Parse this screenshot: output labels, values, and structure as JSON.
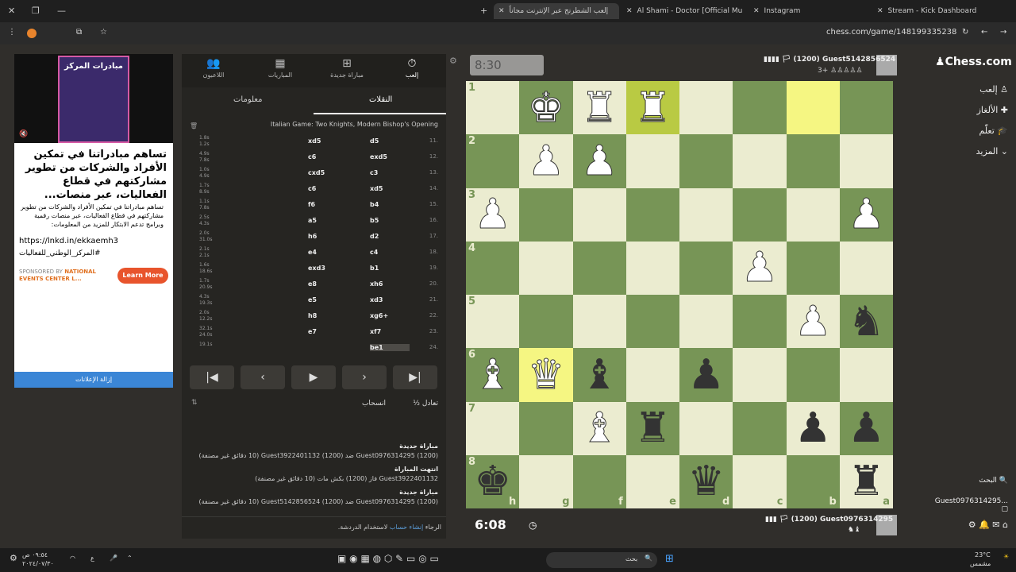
{
  "tabs": [
    {
      "label": "إلعب الشطرنج عبر الإنترنت مجاناً"
    },
    {
      "label": "Al Shami - Doctor [Official Mu"
    },
    {
      "label": "Instagram"
    },
    {
      "label": "Stream - Kick Dashboard"
    }
  ],
  "address": {
    "url": "chess.com/game/148199335238"
  },
  "ad": {
    "image_text": "مبادرات المركز",
    "title": "تساهم مبادراتنا في تمكين الأفراد والشركات من تطوير مشاركتهم في قطاع الفعاليات، عبر منصات...",
    "body": "تساهم مبادراتنا في تمكين الأفراد والشركات من تطوير مشاركتهم في قطاع الفعاليات، عبر منصات رقمية وبرامج تدعم الابتكار للمزيد من المعلومات:",
    "link": "https://lnkd.in/ekkaemh3",
    "hashtag": "المركز_الوطني_للفعاليات#",
    "sponsored_label": "SPONSORED BY",
    "sponsor": "NATIONAL EVENTS CENTER L...",
    "cta": "Learn More",
    "remove": "إزالة الإعلانات"
  },
  "panel": {
    "nav": [
      {
        "label": "إلعب",
        "icon": "stopwatch-icon"
      },
      {
        "label": "مباراة جديدة",
        "icon": "plus-icon"
      },
      {
        "label": "المباريات",
        "icon": "board-icon"
      },
      {
        "label": "اللاعبون",
        "icon": "players-icon"
      }
    ],
    "tab_moves": "النقلات",
    "tab_info": "معلومات",
    "opening": "Italian Game: Two Knights, Modern Bishop's Opening",
    "moves": [
      {
        "n": "11.",
        "w": "d5",
        "b": "xd5",
        "tw": "1.8s",
        "tb": "1.2s"
      },
      {
        "n": "12.",
        "w": "exd5",
        "b": "c6",
        "tw": "4.9s",
        "tb": "7.8s"
      },
      {
        "n": "13.",
        "w": "c3",
        "b": "cxd5",
        "tw": "1.0s",
        "tb": "4.9s"
      },
      {
        "n": "14.",
        "w": "xd5",
        "b": "c6",
        "tw": "1.7s",
        "tb": "8.9s"
      },
      {
        "n": "15.",
        "w": "b4",
        "b": "f6",
        "tw": "1.1s",
        "tb": "7.8s"
      },
      {
        "n": "16.",
        "w": "b5",
        "b": "a5",
        "tw": "2.5s",
        "tb": "4.3s"
      },
      {
        "n": "17.",
        "w": "d2",
        "b": "h6",
        "tw": "2.0s",
        "tb": "31.0s"
      },
      {
        "n": "18.",
        "w": "c4",
        "b": "e4",
        "tw": "2.1s",
        "tb": "2.1s"
      },
      {
        "n": "19.",
        "w": "b1",
        "b": "exd3",
        "tw": "1.6s",
        "tb": "18.6s"
      },
      {
        "n": "20.",
        "w": "xh6",
        "b": "e8",
        "tw": "1.7s",
        "tb": "20.9s"
      },
      {
        "n": "21.",
        "w": "xd3",
        "b": "e5",
        "tw": "4.3s",
        "tb": "19.3s"
      },
      {
        "n": "22.",
        "w": "xg6+",
        "b": "h8",
        "tw": "2.0s",
        "tb": "12.2s"
      },
      {
        "n": "23.",
        "w": "xf7",
        "b": "e7",
        "tw": "32.1s",
        "tb": "24.0s"
      },
      {
        "n": "24.",
        "w": "be1",
        "b": "",
        "tw": "19.1s",
        "tb": ""
      }
    ],
    "controls": {
      "first": "|◀",
      "prev": "‹",
      "play": "▶",
      "next": "›",
      "last": "▶|"
    },
    "draw": "½ تعادل",
    "resign": "انسحاب",
    "events": [
      {
        "title": "مباراة جديدة",
        "text": "Guest0976314295 (1200) ضد Guest3922401132 (1200) (10 دقائق غير مصنفة)"
      },
      {
        "title": "انتهت المباراة",
        "text": "Guest3922401132 فاز (1200) بكش مات (10 دقائق غير مصنفة)"
      },
      {
        "title": "مباراة جديدة",
        "text": "Guest0976314295 (1200) ضد Guest5142856524 (1200) (10 دقائق غير مصنفة)"
      }
    ],
    "chat_note_pre": "الرجاء ",
    "chat_note_link": "إنشاء حساب",
    "chat_note_post": " لاستخدام الدردشة."
  },
  "top_player": {
    "name": "Guest5142856524",
    "rating": "(1200)",
    "clock": "8:30",
    "extra": "3+"
  },
  "bottom_player": {
    "name": "Guest0976314295",
    "rating": "(1200)",
    "clock": "6:08"
  },
  "ranks": [
    "1",
    "2",
    "3",
    "4",
    "5",
    "6",
    "7",
    "8"
  ],
  "files": [
    "h",
    "g",
    "f",
    "e",
    "d",
    "c",
    "b",
    "a"
  ],
  "board": [
    [
      "",
      "wK",
      "wR",
      "wR",
      "",
      "",
      "",
      ""
    ],
    [
      "",
      "wP",
      "wP",
      "",
      "",
      "",
      "",
      ""
    ],
    [
      "wP",
      "",
      "",
      "",
      "",
      "",
      "",
      "wP"
    ],
    [
      "",
      "",
      "",
      "",
      "",
      "wP",
      "",
      ""
    ],
    [
      "",
      "",
      "",
      "",
      "",
      "",
      "wP",
      "bN"
    ],
    [
      "wB",
      "wQ",
      "bB",
      "",
      "bP",
      "",
      "",
      ""
    ],
    [
      "",
      "",
      "wB",
      "bR",
      "",
      "",
      "bP",
      "bP"
    ],
    [
      "bK",
      "",
      "",
      "",
      "bQ",
      "",
      "",
      "bR"
    ]
  ],
  "highlights": [
    {
      "r": 0,
      "c": 3
    },
    {
      "r": 0,
      "c": 6
    },
    {
      "r": 5,
      "c": 1
    }
  ],
  "sidenav": {
    "logo": "Chess.com",
    "items": [
      "إلعب",
      "الألغاز",
      "تعلّم",
      "المزيد"
    ],
    "search": "البحث",
    "user": "Guest0976314295..."
  },
  "taskbar": {
    "time": "٠٩:٥٤ ص",
    "date": "٢٠٢٤/٠٧/٣٠",
    "search": "بحث",
    "weather": "23°C",
    "weather_desc": "مشمس",
    "lang": "ع"
  }
}
